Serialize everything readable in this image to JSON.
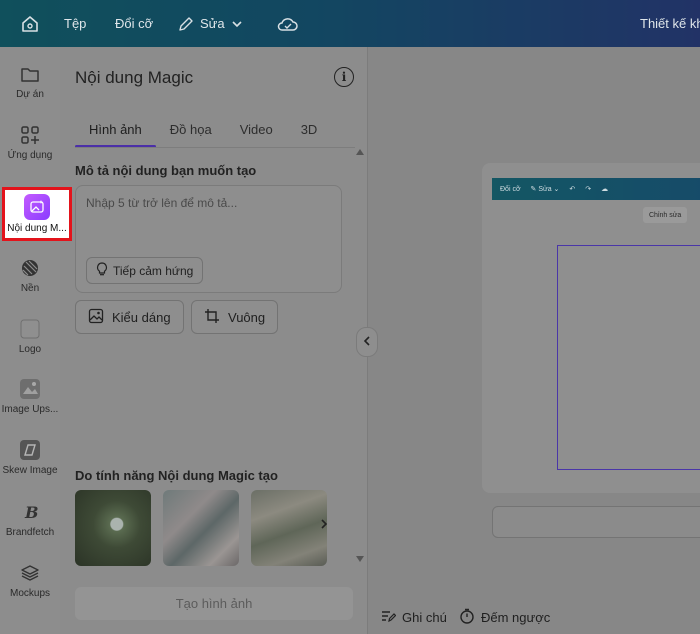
{
  "topbar": {
    "file": "Tệp",
    "resize": "Đổi cỡ",
    "edit": "Sửa",
    "design_name": "Thiết kế khô"
  },
  "rail": {
    "items": [
      {
        "label": "Dự án",
        "icon": "folder-icon"
      },
      {
        "label": "Ứng dụng",
        "icon": "apps-icon"
      },
      {
        "label": "Nội dung M...",
        "icon": "magic-media-icon"
      },
      {
        "label": "Nền",
        "icon": "background-icon"
      },
      {
        "label": "Logo",
        "icon": "logo-icon"
      },
      {
        "label": "Image Ups...",
        "icon": "image-upscaler-icon"
      },
      {
        "label": "Skew Image",
        "icon": "skew-image-icon"
      },
      {
        "label": "Brandfetch",
        "icon": "brandfetch-icon"
      },
      {
        "label": "Mockups",
        "icon": "mockups-icon"
      }
    ]
  },
  "panel": {
    "title": "Nội dung Magic",
    "tabs": [
      "Hình ảnh",
      "Đồ họa",
      "Video",
      "3D"
    ],
    "prompt_label": "Mô tả nội dung bạn muốn tạo",
    "prompt_placeholder": "Nhập 5 từ trở lên để mô tả...",
    "inspire_button": "Tiếp cảm hứng",
    "style_button": "Kiểu dáng",
    "aspect_button": "Vuông",
    "generated_label": "Do tính năng Nội dung Magic tạo",
    "create_button": "Tạo hình ảnh"
  },
  "preview": {
    "resize": "Đổi cỡ",
    "edit": "Sửa",
    "edit_chip": "Chỉnh sửa"
  },
  "bottom": {
    "notes": "Ghi chú",
    "timer": "Đếm ngược"
  },
  "colors": {
    "highlight": "#e3131b",
    "active_tab": "#4b2fa8",
    "magic": "#a64bff"
  }
}
